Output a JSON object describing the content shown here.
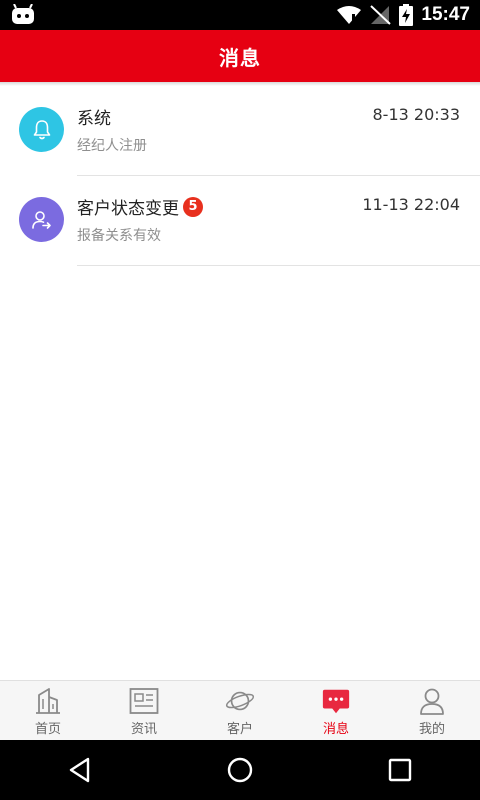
{
  "status_bar": {
    "time": "15:47"
  },
  "header": {
    "title": "消息",
    "color": "#e60012"
  },
  "messages": [
    {
      "title": "系统",
      "subtitle": "经纪人注册",
      "time": "8-13 20:33",
      "icon": "bell-icon",
      "icon_color": "#2ec5e4",
      "badge": null
    },
    {
      "title": "客户状态变更",
      "subtitle": "报备关系有效",
      "time": "11-13 22:04",
      "icon": "user-transfer-icon",
      "icon_color": "#7b6be0",
      "badge": "5",
      "badge_color": "#e8301e"
    }
  ],
  "tabs": [
    {
      "label": "首页",
      "icon": "building-icon",
      "active": false
    },
    {
      "label": "资讯",
      "icon": "newspaper-icon",
      "active": false
    },
    {
      "label": "客户",
      "icon": "planet-icon",
      "active": false
    },
    {
      "label": "消息",
      "icon": "chat-bubble-icon",
      "active": true
    },
    {
      "label": "我的",
      "icon": "person-icon",
      "active": false
    }
  ],
  "accent_color": "#e60012"
}
